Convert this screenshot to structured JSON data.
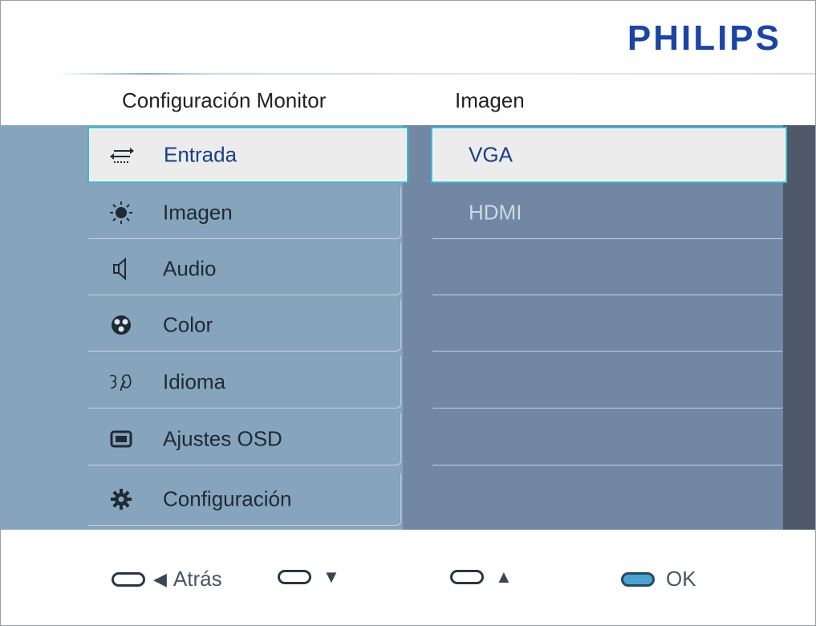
{
  "brand": "PHILIPS",
  "headers": {
    "left": "Configuración Monitor",
    "right": "Imagen"
  },
  "menu": {
    "items": [
      {
        "label": "Entrada",
        "icon": "input-arrows-icon",
        "selected": true
      },
      {
        "label": "Imagen",
        "icon": "brightness-sun-icon",
        "selected": false
      },
      {
        "label": "Audio",
        "icon": "speaker-icon",
        "selected": false
      },
      {
        "label": "Color",
        "icon": "color-palette-icon",
        "selected": false
      },
      {
        "label": "Idioma",
        "icon": "language-speech-icon",
        "selected": false
      },
      {
        "label": "Ajustes OSD",
        "icon": "osd-screen-icon",
        "selected": false
      },
      {
        "label": "Configuración",
        "icon": "gear-icon",
        "selected": false
      }
    ]
  },
  "submenu": {
    "items": [
      {
        "label": "VGA",
        "selected": true
      },
      {
        "label": "HDMI",
        "selected": false
      }
    ]
  },
  "controls": {
    "back_label": "Atrás",
    "ok_label": "OK",
    "back_glyph": "◀",
    "down_glyph": "▼",
    "up_glyph": "▲"
  },
  "colors": {
    "brand": "#1b45a5",
    "menu_band": "#86a4bb",
    "submenu_panel": "#7187a3",
    "selection_border": "#3dbcd4",
    "selection_fill": "#ececec"
  }
}
